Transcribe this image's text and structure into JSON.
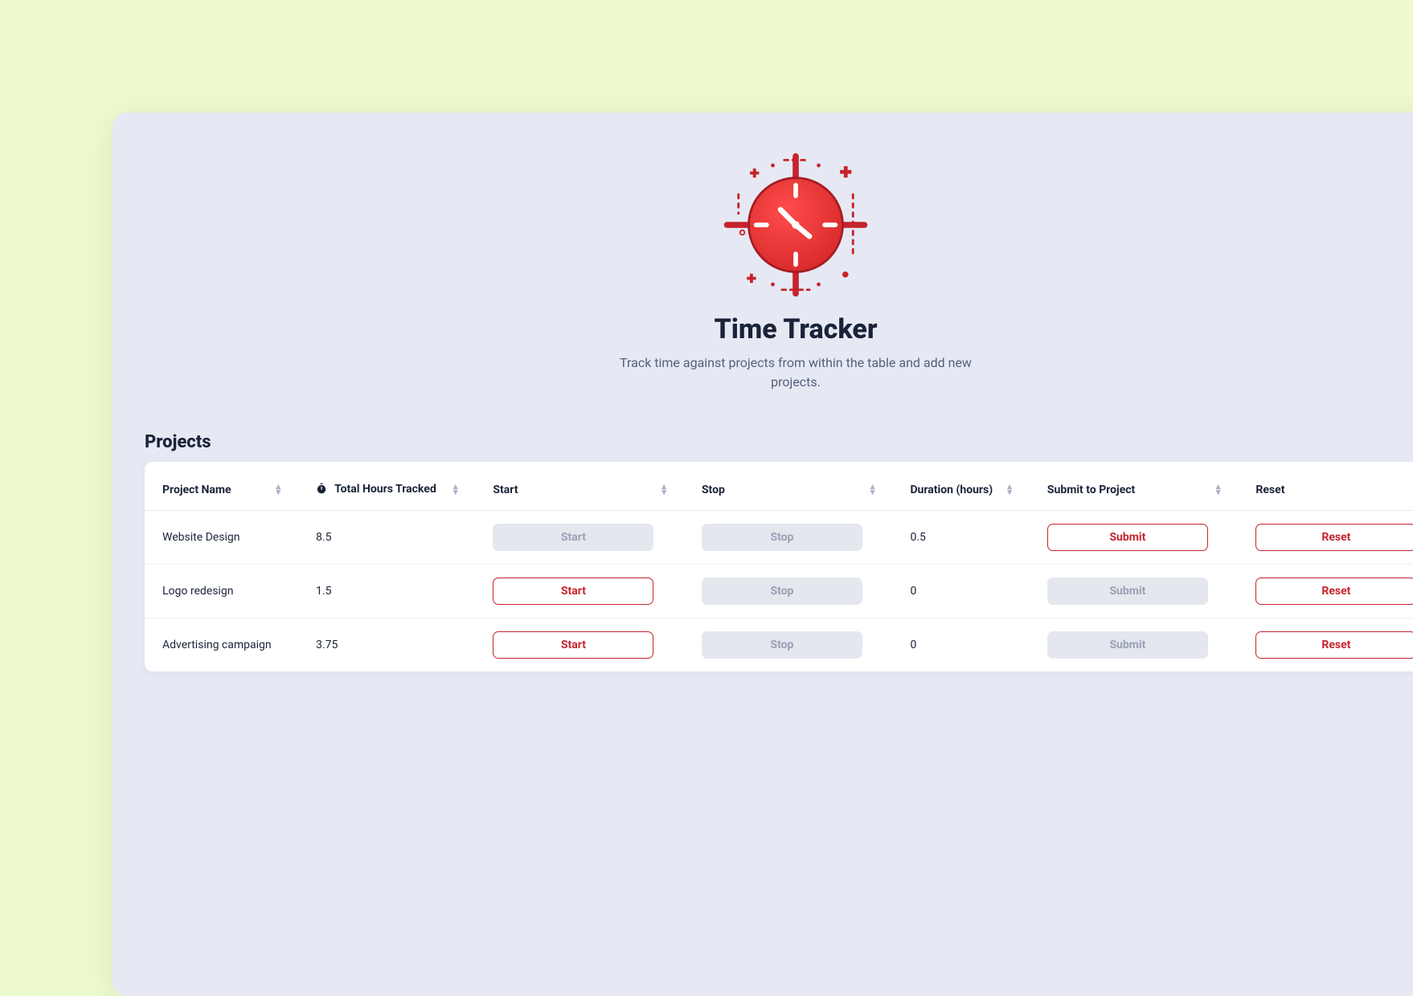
{
  "app": {
    "title": "Time Tracker",
    "subtitle": "Track time against projects from within the table and add new projects."
  },
  "section": {
    "projects_title": "Projects"
  },
  "columns": {
    "project_name": "Project Name",
    "total_hours": "Total Hours Tracked",
    "start": "Start",
    "stop": "Stop",
    "duration": "Duration (hours)",
    "submit": "Submit to Project",
    "reset": "Reset"
  },
  "buttons": {
    "start": "Start",
    "stop": "Stop",
    "submit": "Submit",
    "reset": "Reset"
  },
  "rows": [
    {
      "name": "Website Design",
      "total_hours": "8.5",
      "duration": "0.5",
      "start_enabled": false,
      "stop_enabled": false,
      "submit_enabled": true,
      "reset_enabled": true
    },
    {
      "name": "Logo redesign",
      "total_hours": "1.5",
      "duration": "0",
      "start_enabled": true,
      "stop_enabled": false,
      "submit_enabled": false,
      "reset_enabled": true
    },
    {
      "name": "Advertising campaign",
      "total_hours": "3.75",
      "duration": "0",
      "start_enabled": true,
      "stop_enabled": false,
      "submit_enabled": false,
      "reset_enabled": true
    }
  ]
}
